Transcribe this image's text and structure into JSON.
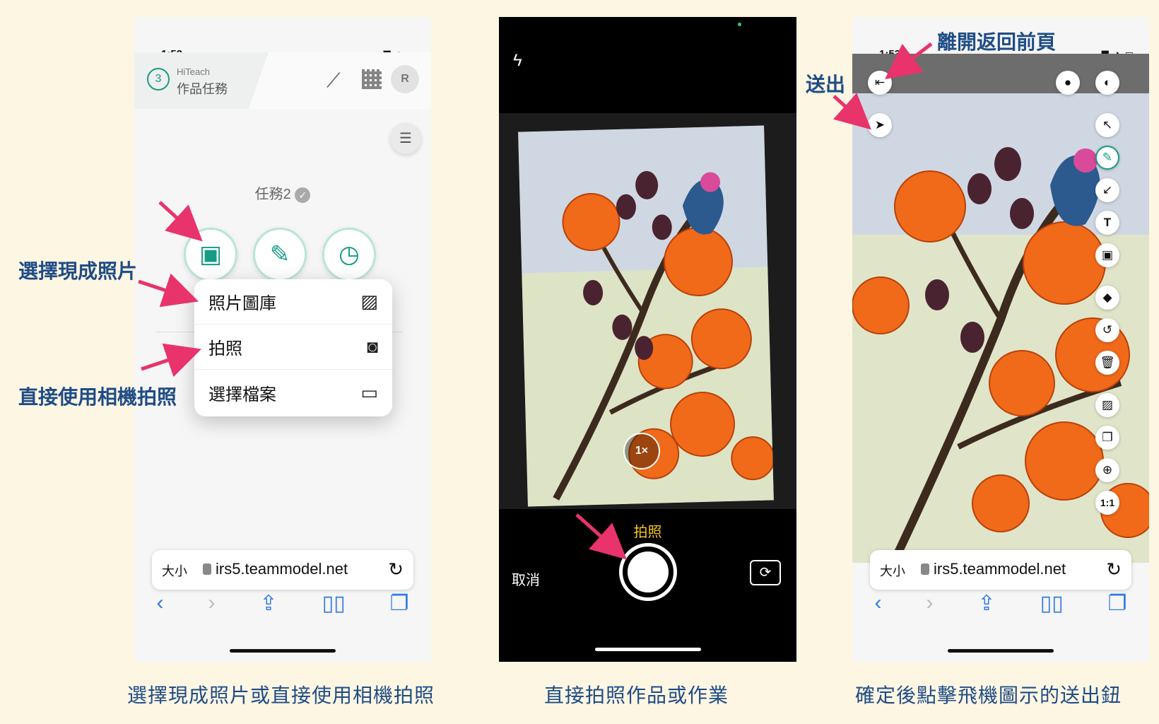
{
  "annotations": {
    "choose_photo": "選擇現成照片",
    "use_camera": "直接使用相機拍照",
    "send": "送出",
    "leave_back": "離開返回前頁"
  },
  "captions": {
    "left": "選擇現成照片或直接使用相機拍照",
    "middle": "直接拍照作品或作業",
    "right": "確定後點擊飛機圖示的送出鈕"
  },
  "left_phone": {
    "time": "1:52",
    "app_badge": "3",
    "app_name": "HiTeach",
    "app_sub": "作品任務",
    "avatar": "R",
    "task_title": "任務2",
    "menu": [
      {
        "label": "照片圖庫",
        "icon": "photo-library-icon"
      },
      {
        "label": "拍照",
        "icon": "camera-icon"
      },
      {
        "label": "選擇檔案",
        "icon": "folder-icon"
      }
    ],
    "url_size": "大小",
    "url": "irs5.teammodel.net"
  },
  "middle_phone": {
    "mode_label": "拍照",
    "cancel": "取消",
    "zoom": "1×"
  },
  "right_phone": {
    "time": "1:53",
    "ratio": "1:1",
    "url_size": "大小",
    "url": "irs5.teammodel.net"
  },
  "colors": {
    "annotation_text": "#1f4c86",
    "arrow": "#e8336b",
    "teal": "#169b85",
    "camera_mode": "#f5c518"
  }
}
